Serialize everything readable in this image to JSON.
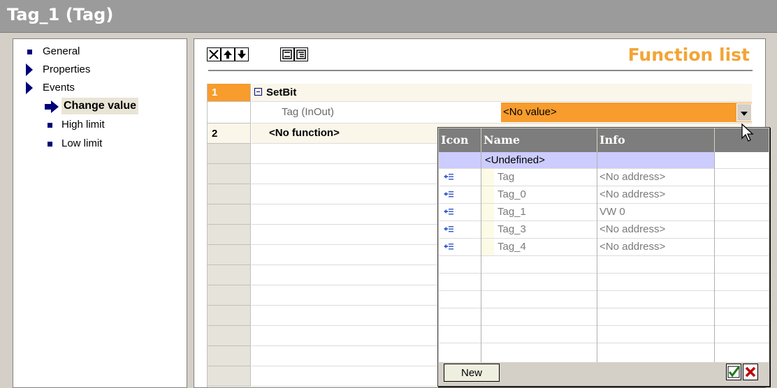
{
  "window": {
    "title": "Tag_1 (Tag)"
  },
  "tree": {
    "items": [
      {
        "label": "General"
      },
      {
        "label": "Properties"
      },
      {
        "label": "Events"
      },
      {
        "label": "Change value"
      },
      {
        "label": "High limit"
      },
      {
        "label": "Low limit"
      }
    ]
  },
  "toolbar": {
    "buttons": [
      "delete-icon",
      "move-up-icon",
      "move-down-icon",
      "collapse-icon",
      "expand-icon"
    ]
  },
  "function_list": {
    "title": "Function list",
    "rows": [
      {
        "number": "1",
        "function": "SetBit",
        "param_name": "Tag (InOut)",
        "param_value": "<No value>"
      },
      {
        "number": "2",
        "function": "<No function>"
      }
    ]
  },
  "dropdown": {
    "columns": {
      "icon": "Icon",
      "name": "Name",
      "info": "Info"
    },
    "undefined_label": "<Undefined>",
    "items": [
      {
        "name": "Tag",
        "info": "<No address>"
      },
      {
        "name": "Tag_0",
        "info": "<No address>"
      },
      {
        "name": "Tag_1",
        "info": "VW 0"
      },
      {
        "name": "Tag_3",
        "info": "<No address>"
      },
      {
        "name": "Tag_4",
        "info": "<No address>"
      }
    ],
    "new_label": "New"
  },
  "colors": {
    "accent": "#f79c2d",
    "title_orange": "#f3a436",
    "selected_row": "#ccccff",
    "tree_blue": "#00007a"
  }
}
